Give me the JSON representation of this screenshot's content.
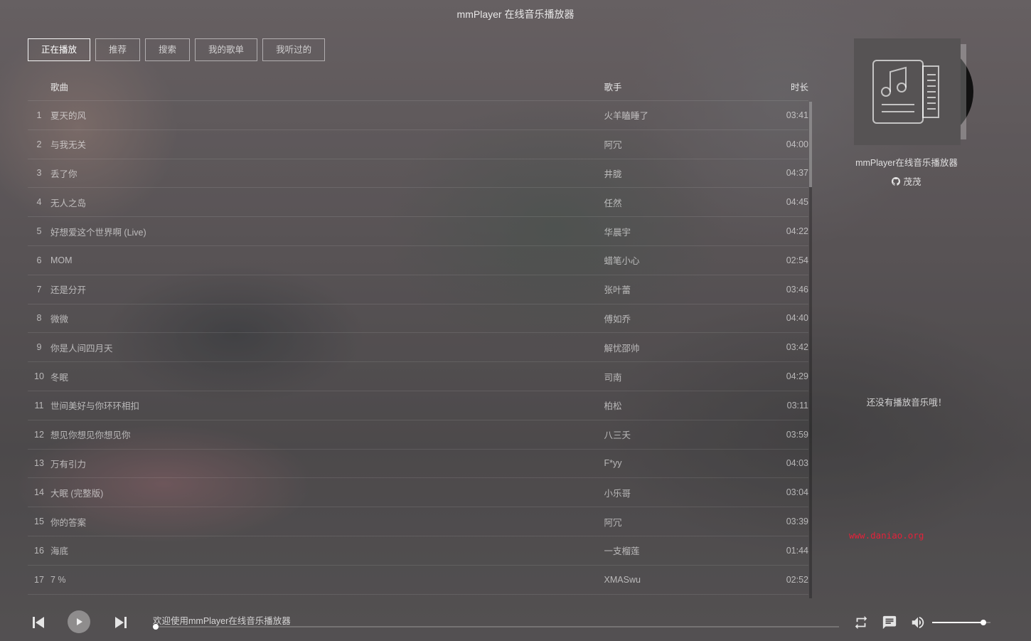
{
  "app": {
    "title": "mmPlayer 在线音乐播放器"
  },
  "tabs": [
    {
      "label": "正在播放",
      "active": true
    },
    {
      "label": "推荐",
      "active": false
    },
    {
      "label": "搜索",
      "active": false
    },
    {
      "label": "我的歌单",
      "active": false
    },
    {
      "label": "我听过的",
      "active": false
    }
  ],
  "list": {
    "headers": {
      "song": "歌曲",
      "singer": "歌手",
      "duration": "时长"
    },
    "rows": [
      {
        "num": "1",
        "name": "夏天的风",
        "singer": "火羊瞌睡了",
        "duration": "03:41"
      },
      {
        "num": "2",
        "name": "与我无关",
        "singer": "阿冗",
        "duration": "04:00"
      },
      {
        "num": "3",
        "name": "丢了你",
        "singer": "井胧",
        "duration": "04:37"
      },
      {
        "num": "4",
        "name": "无人之岛",
        "singer": "任然",
        "duration": "04:45"
      },
      {
        "num": "5",
        "name": "好想爱这个世界啊 (Live)",
        "singer": "华晨宇",
        "duration": "04:22"
      },
      {
        "num": "6",
        "name": "MOM",
        "singer": "蜡笔小心",
        "duration": "02:54"
      },
      {
        "num": "7",
        "name": "还是分开",
        "singer": "张叶蕾",
        "duration": "03:46"
      },
      {
        "num": "8",
        "name": "微微",
        "singer": "傅如乔",
        "duration": "04:40"
      },
      {
        "num": "9",
        "name": "你是人间四月天",
        "singer": "解忧邵帅",
        "duration": "03:42"
      },
      {
        "num": "10",
        "name": "冬眠",
        "singer": "司南",
        "duration": "04:29"
      },
      {
        "num": "11",
        "name": "世间美好与你环环相扣",
        "singer": "柏松",
        "duration": "03:11"
      },
      {
        "num": "12",
        "name": "想见你想见你想见你",
        "singer": "八三夭",
        "duration": "03:59"
      },
      {
        "num": "13",
        "name": "万有引力",
        "singer": "F*yy",
        "duration": "04:03"
      },
      {
        "num": "14",
        "name": "大眠 (完整版)",
        "singer": "小乐哥",
        "duration": "03:04"
      },
      {
        "num": "15",
        "name": "你的答案",
        "singer": "阿冗",
        "duration": "03:39"
      },
      {
        "num": "16",
        "name": "海底",
        "singer": "一支榴莲",
        "duration": "01:44"
      },
      {
        "num": "17",
        "name": "7 %",
        "singer": "XMASwu",
        "duration": "02:52"
      }
    ]
  },
  "sidebar": {
    "cover_icon": "music-note-document-icon",
    "player_name": "mmPlayer在线音乐播放器",
    "author": "茂茂",
    "author_icon": "github-icon",
    "empty_message": "还没有播放音乐哦！"
  },
  "watermark": "www.daniao.org",
  "player": {
    "welcome": "欢迎使用mmPlayer在线音乐播放器",
    "progress": 0,
    "volume": 0.88,
    "icons": {
      "prev": "skip-previous-icon",
      "play": "play-icon",
      "next": "skip-next-icon",
      "mode": "repeat-icon",
      "comment": "comment-icon",
      "volume": "volume-icon"
    }
  },
  "colors": {
    "watermark": "#e4223a",
    "text": "#ffffff"
  }
}
